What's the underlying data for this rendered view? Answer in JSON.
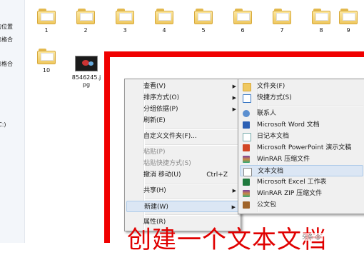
{
  "nav": {
    "items": [
      "的位置",
      "表格合",
      "表格合",
      "(C:)"
    ]
  },
  "files": {
    "row1": [
      "1",
      "2",
      "3",
      "4",
      "5",
      "6",
      "7",
      "8",
      "9"
    ],
    "row2_folder": "10",
    "image_name_line1": "8546245.j",
    "image_name_line2": "pg"
  },
  "context_menu": {
    "view": "查看(V)",
    "sort": "排序方式(O)",
    "group": "分组依据(P)",
    "refresh": "刷新(E)",
    "customize": "自定义文件夹(F)...",
    "paste": "粘贴(P)",
    "paste_shortcut": "粘贴快捷方式(S)",
    "undo_move": "撤消 移动(U)",
    "undo_shortcut": "Ctrl+Z",
    "share": "共享(H)",
    "new": "新建(W)",
    "properties": "属性(R)"
  },
  "new_submenu": {
    "folder": "文件夹(F)",
    "shortcut": "快捷方式(S)",
    "contact": "联系人",
    "word": "Microsoft Word 文档",
    "journal": "日记本文档",
    "powerpoint": "Microsoft PowerPoint 演示文稿",
    "winrar": "WinRAR 压缩文件",
    "text_doc": "文本文档",
    "excel": "Microsoft Excel 工作表",
    "winrar_zip": "WinRAR ZIP 压缩文件",
    "briefcase": "公文包"
  },
  "annotation": "创建一个文本文档",
  "watermark": "头条 @",
  "colors": {
    "annotation_red": "#e00000",
    "menu_bg": "#f0f0f0",
    "highlight": "#dbe6f4"
  }
}
